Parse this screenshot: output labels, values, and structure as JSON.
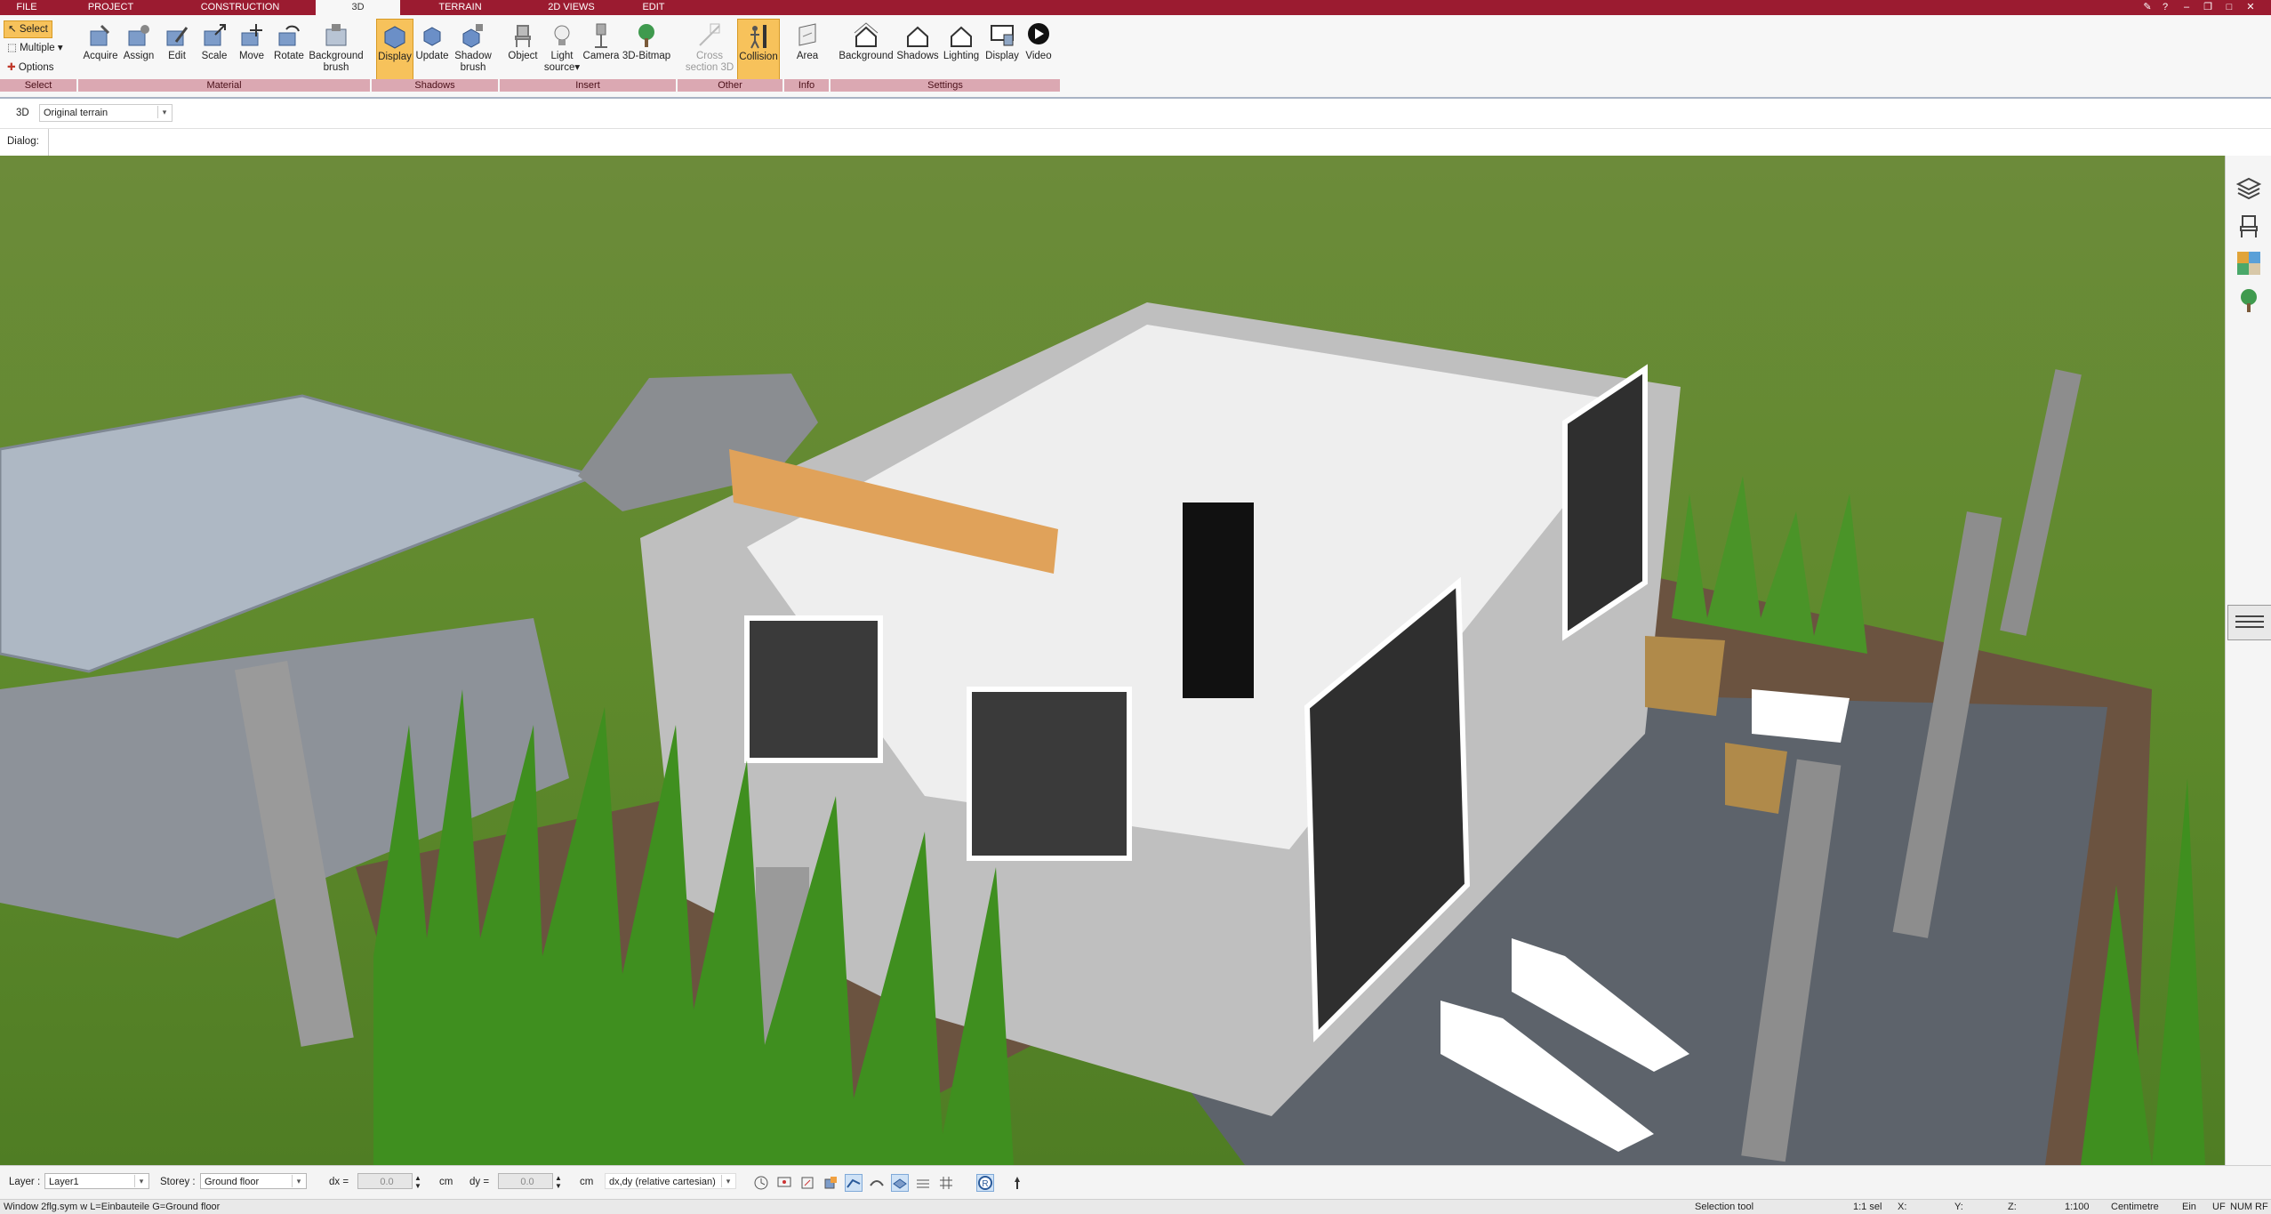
{
  "menu": {
    "tabs": [
      "FILE",
      "PROJECT",
      "CONSTRUCTION",
      "3D",
      "TERRAIN",
      "2D VIEWS",
      "EDIT"
    ],
    "active": "3D"
  },
  "ribbon": {
    "select": {
      "select": "Select",
      "multiple": "Multiple",
      "options": "Options"
    },
    "material": {
      "acquire": "Acquire",
      "assign": "Assign",
      "edit": "Edit",
      "scale": "Scale",
      "move": "Move",
      "rotate": "Rotate",
      "background_brush_1": "Background",
      "background_brush_2": "brush"
    },
    "shadows": {
      "display": "Display",
      "update": "Update",
      "shadow_brush_1": "Shadow",
      "shadow_brush_2": "brush"
    },
    "insert": {
      "object": "Object",
      "light_source_1": "Light",
      "light_source_2": "source",
      "camera": "Camera",
      "bitmap": "3D-Bitmap"
    },
    "other": {
      "cross_section_1": "Cross",
      "cross_section_2": "section 3D",
      "collision": "Collision"
    },
    "info": {
      "area": "Area"
    },
    "settings": {
      "background": "Background",
      "shadows": "Shadows",
      "lighting": "Lighting",
      "display": "Display",
      "video": "Video"
    },
    "groups": [
      "Select",
      "Material",
      "Shadows",
      "Insert",
      "Other",
      "Info",
      "Settings"
    ]
  },
  "context": {
    "mode": "3D",
    "terrain": "Original terrain",
    "dialog_label": "Dialog:"
  },
  "bottom": {
    "layer_label": "Layer :",
    "layer_value": "Layer1",
    "storey_label": "Storey :",
    "storey_value": "Ground floor",
    "dx_label": "dx =",
    "dx_value": "0.0",
    "dx_unit": "cm",
    "dy_label": "dy =",
    "dy_value": "0.0",
    "dy_unit": "cm",
    "coord_mode": "dx,dy (relative cartesian)"
  },
  "status": {
    "message": "Window 2flg.sym w L=Einbauteile G=Ground floor",
    "tool": "Selection tool",
    "selection": "1:1 sel",
    "x": "X:",
    "y": "Y:",
    "z": "Z:",
    "scale": "1:100",
    "units": "Centimetre",
    "ein": "Ein",
    "uf": "UF",
    "num": "NUM",
    "rf": "RF"
  },
  "colors": {
    "brand": "#9b1b30",
    "highlight": "#f7c25b",
    "group_band": "#dba8b2",
    "grass": "#5f8f2f"
  }
}
